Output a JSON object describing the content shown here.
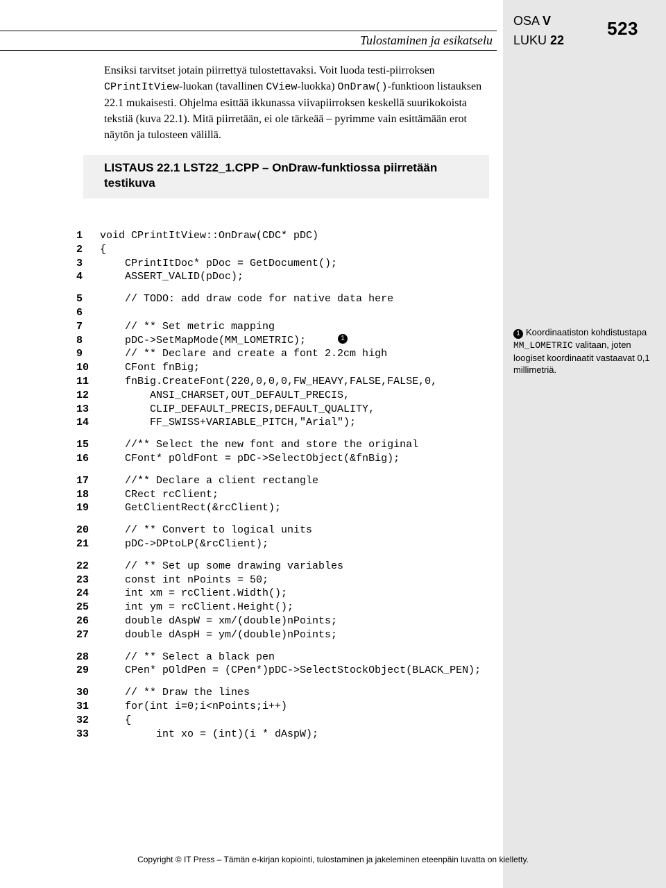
{
  "header": {
    "osa_label": "OSA",
    "osa_num": "V",
    "luku_label": "LUKU",
    "luku_num": "22",
    "subtitle": "Tulostaminen ja esikatselu",
    "page_number": "523"
  },
  "para": {
    "t1": "Ensiksi tarvitset jotain piirrettyä tulostettavaksi. Voit luoda testi-piirroksen ",
    "c1": "CPrintItView",
    "t2": "-luokan (tavallinen ",
    "c2": "CView",
    "t3": "-luokka) ",
    "c3": "OnDraw()",
    "t4": "-funktioon listauksen 22.1 mukaisesti. Ohjelma esittää ikkunassa viivapiirroksen keskellä suurikokoista tekstiä (kuva 22.1). Mitä piirretään, ei ole tärkeää – pyrimme vain esittämään erot näytön ja tulosteen välillä."
  },
  "listing_head": "LISTAUS 22.1  LST22_1.CPP – OnDraw-funktiossa piirretään testikuva",
  "code": [
    {
      "n": "1",
      "t": "void CPrintItView::OnDraw(CDC* pDC)"
    },
    {
      "n": "2",
      "t": "{"
    },
    {
      "n": "3",
      "t": "    CPrintItDoc* pDoc = GetDocument();"
    },
    {
      "n": "4",
      "t": "    ASSERT_VALID(pDoc);"
    },
    {
      "gap": true
    },
    {
      "n": "5",
      "t": "    // TODO: add draw code for native data here"
    },
    {
      "n": "6",
      "t": ""
    },
    {
      "n": "7",
      "t": "    // ** Set metric mapping"
    },
    {
      "n": "8",
      "t": "    pDC->SetMapMode(MM_LOMETRIC);",
      "mark": true
    },
    {
      "n": "9",
      "t": "    // ** Declare and create a font 2.2cm high"
    },
    {
      "n": "10",
      "t": "    CFont fnBig;"
    },
    {
      "n": "11",
      "t": "    fnBig.CreateFont(220,0,0,0,FW_HEAVY,FALSE,FALSE,0,"
    },
    {
      "n": "12",
      "t": "        ANSI_CHARSET,OUT_DEFAULT_PRECIS,"
    },
    {
      "n": "13",
      "t": "        CLIP_DEFAULT_PRECIS,DEFAULT_QUALITY,"
    },
    {
      "n": "14",
      "t": "        FF_SWISS+VARIABLE_PITCH,\"Arial\");"
    },
    {
      "gap": true
    },
    {
      "n": "15",
      "t": "    //** Select the new font and store the original"
    },
    {
      "n": "16",
      "t": "    CFont* pOldFont = pDC->SelectObject(&fnBig);"
    },
    {
      "gap": true
    },
    {
      "n": "17",
      "t": "    //** Declare a client rectangle"
    },
    {
      "n": "18",
      "t": "    CRect rcClient;"
    },
    {
      "n": "19",
      "t": "    GetClientRect(&rcClient);"
    },
    {
      "gap": true
    },
    {
      "n": "20",
      "t": "    // ** Convert to logical units"
    },
    {
      "n": "21",
      "t": "    pDC->DPtoLP(&rcClient);"
    },
    {
      "gap": true
    },
    {
      "n": "22",
      "t": "    // ** Set up some drawing variables"
    },
    {
      "n": "23",
      "t": "    const int nPoints = 50;"
    },
    {
      "n": "24",
      "t": "    int xm = rcClient.Width();"
    },
    {
      "n": "25",
      "t": "    int ym = rcClient.Height();"
    },
    {
      "n": "26",
      "t": "    double dAspW = xm/(double)nPoints;"
    },
    {
      "n": "27",
      "t": "    double dAspH = ym/(double)nPoints;"
    },
    {
      "gap": true
    },
    {
      "n": "28",
      "t": "    // ** Select a black pen"
    },
    {
      "n": "29",
      "t": "    CPen* pOldPen = (CPen*)pDC->SelectStockObject(BLACK_PEN);"
    },
    {
      "gap": true
    },
    {
      "n": "30",
      "t": "    // ** Draw the lines"
    },
    {
      "n": "31",
      "t": "    for(int i=0;i<nPoints;i++)"
    },
    {
      "n": "32",
      "t": "    {"
    },
    {
      "n": "33",
      "t": "         int xo = (int)(i * dAspW);"
    }
  ],
  "sidenote": {
    "num": "1",
    "t1": "Koordinaatiston kohdistustapa ",
    "c1": "MM_LOMETRIC",
    "t2": " valitaan, joten loogiset koordinaatit vastaavat 0,1 millimetriä."
  },
  "footer": "Copyright © IT Press – Tämän e-kirjan kopiointi, tulostaminen ja jakeleminen eteenpäin luvatta on kielletty."
}
